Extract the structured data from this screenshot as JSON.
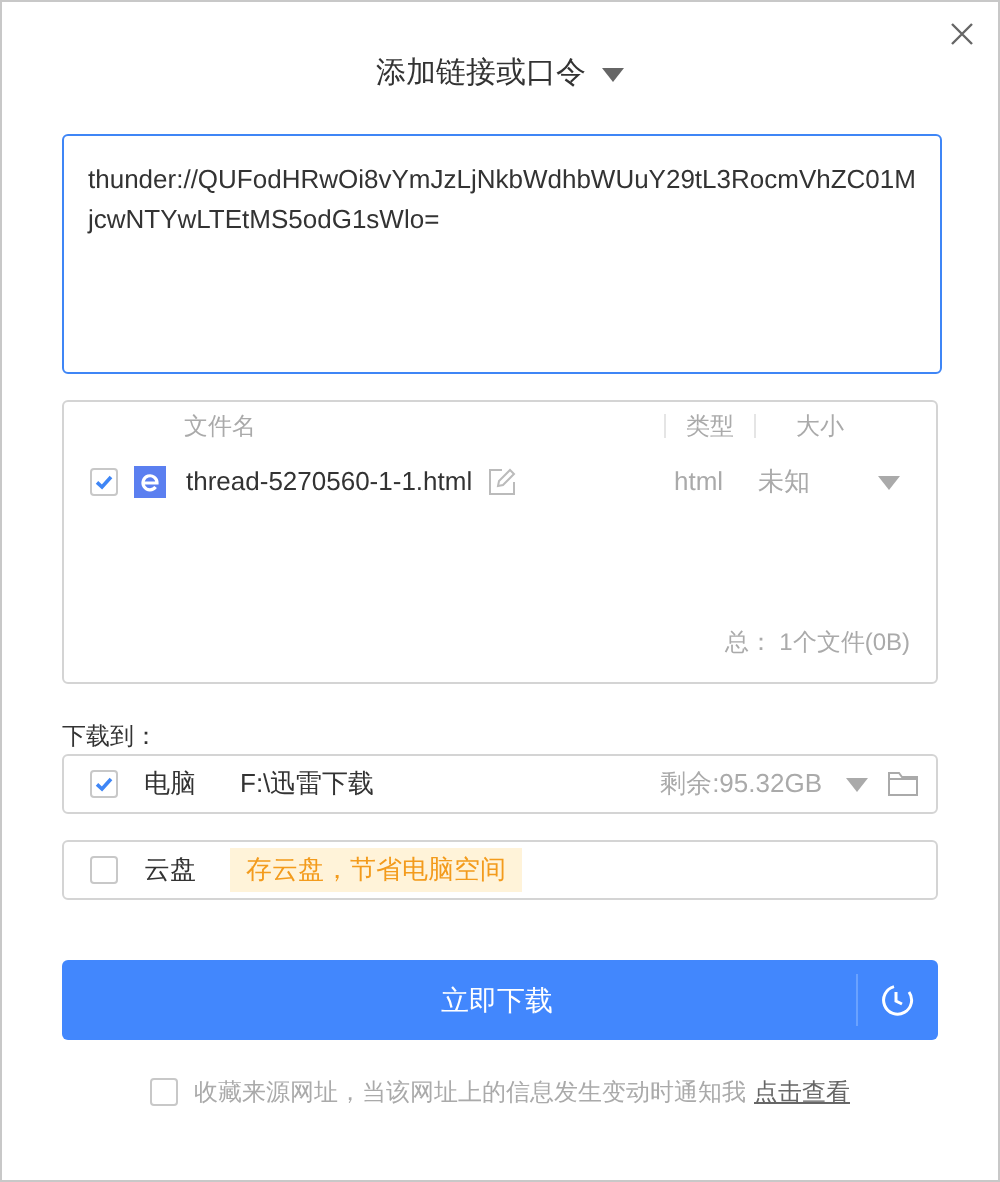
{
  "window": {
    "title": "添加链接或口令"
  },
  "link_field": {
    "value": "thunder://QUFodHRwOi8vYmJzLjNkbWdhbWUuY29tL3RocmVhZC01MjcwNTYwLTEtMS5odG1sWlo="
  },
  "file_list": {
    "columns": [
      "文件名",
      "类型",
      "大小"
    ],
    "files": [
      {
        "checked": true,
        "name": "thread-5270560-1-1.html",
        "type": "html",
        "size": "未知"
      }
    ],
    "summary": "总： 1个文件(0B)"
  },
  "destination": {
    "label": "下载到：",
    "targets": [
      {
        "kind": "local",
        "checked": true,
        "name": "电脑",
        "path": "F:\\迅雷下载",
        "free": "剩余:95.32GB"
      },
      {
        "kind": "cloud",
        "checked": false,
        "name": "云盘",
        "tip": "存云盘，节省电脑空间"
      }
    ]
  },
  "download_button": "立即下载",
  "footer": {
    "checked": false,
    "text": "收藏来源网址，当该网址上的信息发生变动时通知我",
    "link": "点击查看"
  }
}
